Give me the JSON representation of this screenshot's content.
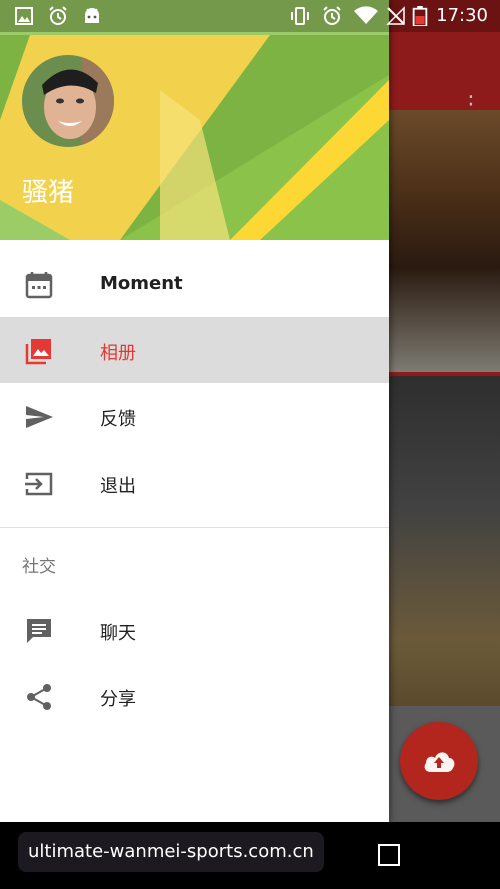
{
  "status_bar": {
    "time": "17:30",
    "left_icons": [
      "image-icon",
      "alarm-icon",
      "android-icon"
    ],
    "right_icons": [
      "vibrate-icon",
      "alarm-icon",
      "wifi-icon",
      "no-signal-icon",
      "battery-icon"
    ]
  },
  "drawer": {
    "user_name": "骚猪",
    "menu": [
      {
        "label": "Moment",
        "icon": "calendar-icon",
        "active": false
      },
      {
        "label": "相册",
        "icon": "photo-album-icon",
        "active": true
      },
      {
        "label": "反馈",
        "icon": "send-icon",
        "active": false
      },
      {
        "label": "退出",
        "icon": "exit-icon",
        "active": false
      }
    ],
    "section_title": "社交",
    "social": [
      {
        "label": "聊天",
        "icon": "chat-icon"
      },
      {
        "label": "分享",
        "icon": "share-icon"
      }
    ]
  },
  "watermark": "ultimate-wanmei-sports.com.cn",
  "colors": {
    "accent": "#e53935",
    "header_green": "#8bc34a",
    "header_yellow": "#f2d24c",
    "app_bar": "#8e1b1b",
    "fab": "#b3261e"
  }
}
